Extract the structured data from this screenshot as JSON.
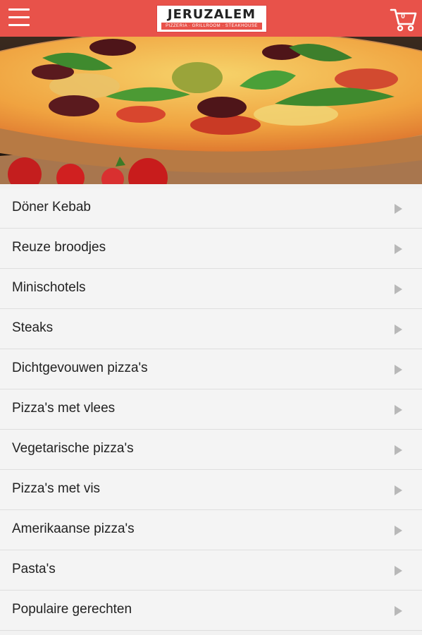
{
  "header": {
    "logo_title": "JERUZALEM",
    "logo_subtitle": "PIZZERIA · GRILLROOM · STEAKHOUSE",
    "cart_count": "0",
    "icons": [
      "menu-icon",
      "cart-icon"
    ]
  },
  "hero": {
    "image": "pizza-photo"
  },
  "menu": {
    "items": [
      {
        "label": "Döner Kebab"
      },
      {
        "label": "Reuze broodjes"
      },
      {
        "label": "Minischotels"
      },
      {
        "label": "Steaks"
      },
      {
        "label": "Dichtgevouwen pizza's"
      },
      {
        "label": "Pizza's met vlees"
      },
      {
        "label": "Vegetarische pizza's"
      },
      {
        "label": "Pizza's met vis"
      },
      {
        "label": "Amerikaanse pizza's"
      },
      {
        "label": "Pasta's"
      },
      {
        "label": "Populaire gerechten"
      }
    ]
  },
  "colors": {
    "brand": "#e8524a",
    "list_bg": "#f4f4f4",
    "divider": "#dedede",
    "arrow": "#b8b8b8"
  }
}
